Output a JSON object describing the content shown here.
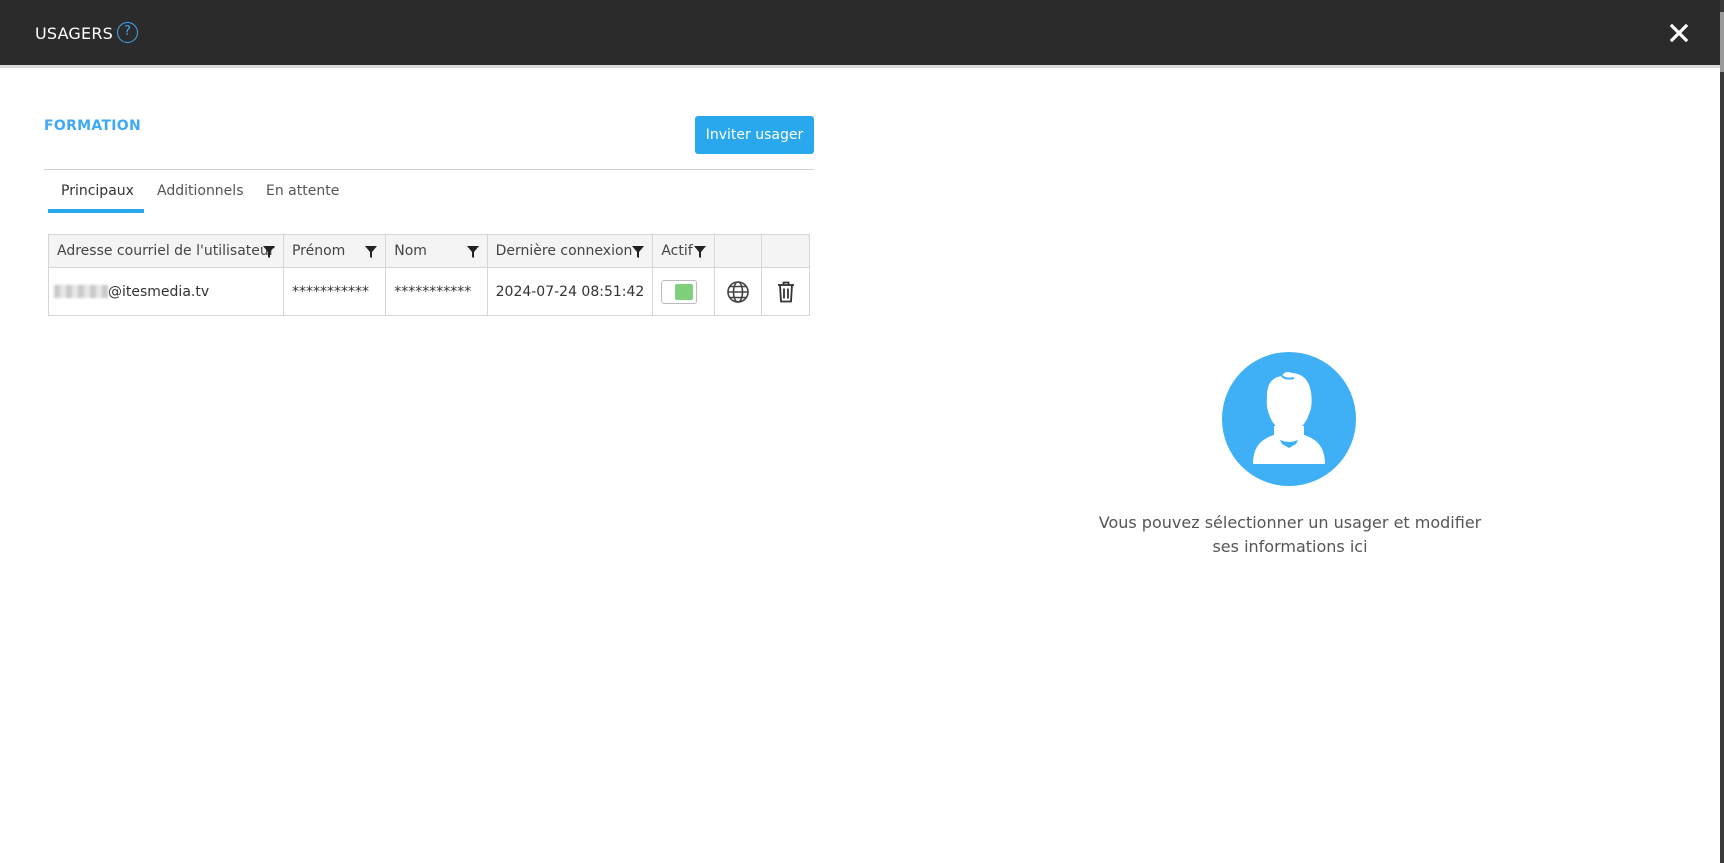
{
  "window": {
    "title": "USAGERS",
    "help_glyph": "?",
    "close_icon": "close-icon"
  },
  "section": {
    "title": "FORMATION",
    "invite_label": "Inviter usager"
  },
  "tabs": [
    {
      "label": "Principaux",
      "active": true
    },
    {
      "label": "Additionnels",
      "active": false
    },
    {
      "label": "En attente",
      "active": false
    }
  ],
  "table": {
    "columns": [
      {
        "label": "Adresse courriel de l'utilisateur",
        "filter": true
      },
      {
        "label": "Prénom",
        "filter": true
      },
      {
        "label": "Nom",
        "filter": true
      },
      {
        "label": "Dernière connexion",
        "filter": true
      },
      {
        "label": "Actif",
        "filter": true
      },
      {
        "label": "",
        "filter": false
      },
      {
        "label": "",
        "filter": false
      }
    ],
    "rows": [
      {
        "email_domain": "@itesmedia.tv",
        "first_name": "***********",
        "last_name": "***********",
        "last_login": "2024-07-24 08:51:42",
        "active": true,
        "actions": [
          "globe-icon",
          "trash-icon"
        ]
      }
    ]
  },
  "placeholder": {
    "icon": "user-avatar-icon",
    "message_line1": "Vous pouvez sélectionner un usager et modifier",
    "message_line2": "ses informations ici"
  },
  "colors": {
    "accent": "#2aa8ee",
    "section_title": "#3fa9f5",
    "titlebar": "#2b2b2b",
    "active_toggle": "#7ed07a",
    "avatar_bg": "#3fb0f5"
  }
}
